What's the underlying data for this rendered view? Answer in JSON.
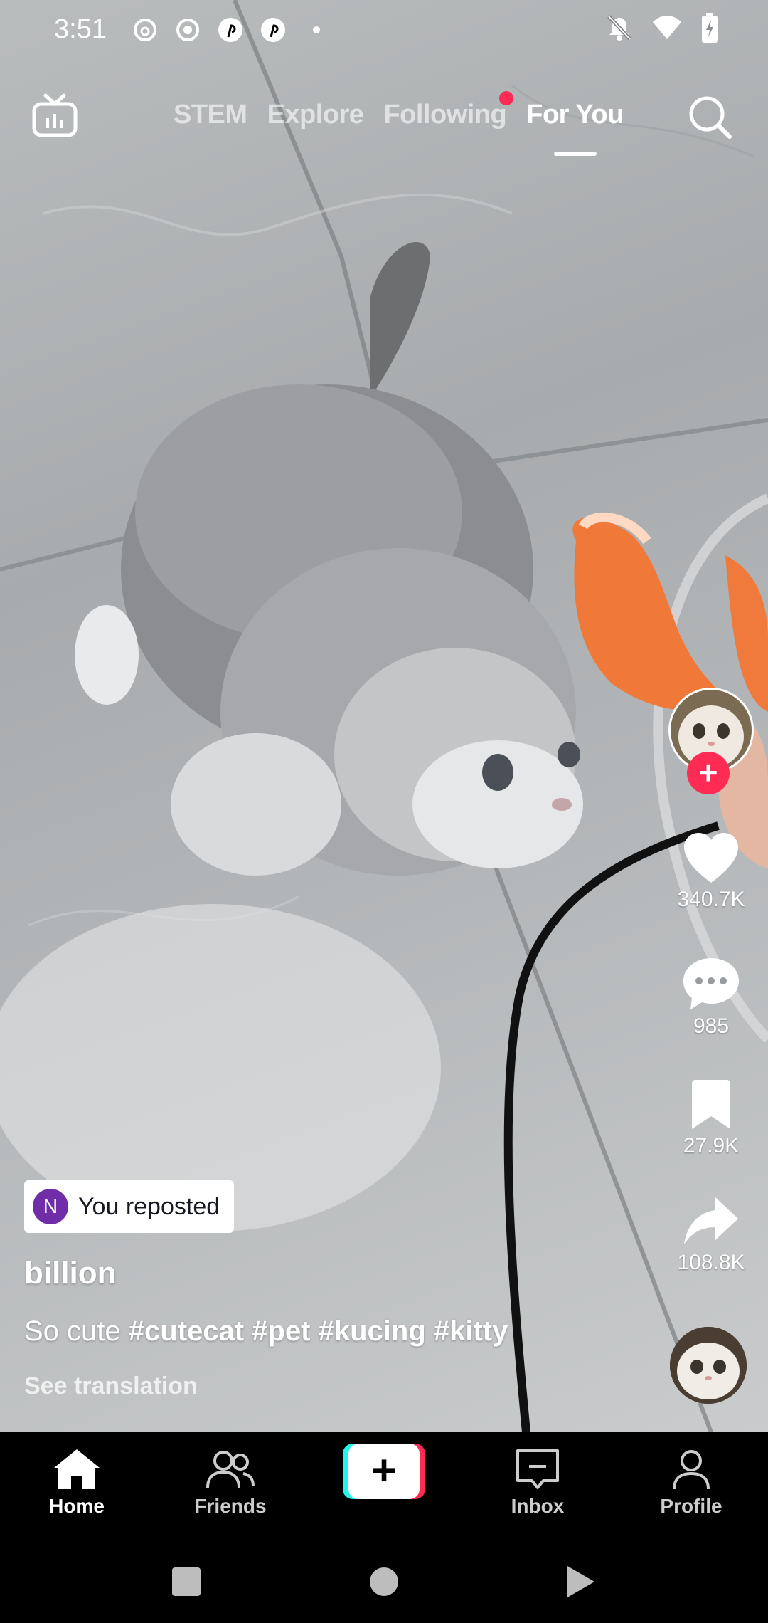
{
  "status_bar": {
    "time": "3:51",
    "left_icons": [
      "threads-icon",
      "record-icon",
      "pinterest-icon",
      "pinterest-icon",
      "dot-icon"
    ],
    "right_icons": [
      "notifications-off-icon",
      "wifi-icon",
      "battery-charging-icon"
    ]
  },
  "top_nav": {
    "tabs": [
      {
        "label": "STEM",
        "active": false
      },
      {
        "label": "Explore",
        "active": false
      },
      {
        "label": "Following",
        "active": false,
        "badge": true
      },
      {
        "label": "For You",
        "active": true
      }
    ]
  },
  "actions": {
    "likes": "340.7K",
    "comments": "985",
    "saves": "27.9K",
    "shares": "108.8K"
  },
  "post": {
    "repost_avatar_letter": "N",
    "repost_label": "You reposted",
    "author": "billion",
    "caption_text": "So cute",
    "hashtags": [
      "#cutecat",
      "#pet",
      "#kucing",
      "#kitty"
    ],
    "see_translation": "See translation"
  },
  "tab_bar": {
    "items": [
      {
        "label": "Home",
        "active": true
      },
      {
        "label": "Friends",
        "active": false
      },
      {
        "label": "",
        "active": false
      },
      {
        "label": "Inbox",
        "active": false
      },
      {
        "label": "Profile",
        "active": false
      }
    ]
  },
  "colors": {
    "accent": "#fe2c55",
    "create_cyan": "#25f4ee",
    "repost_avatar": "#6f2da8"
  }
}
